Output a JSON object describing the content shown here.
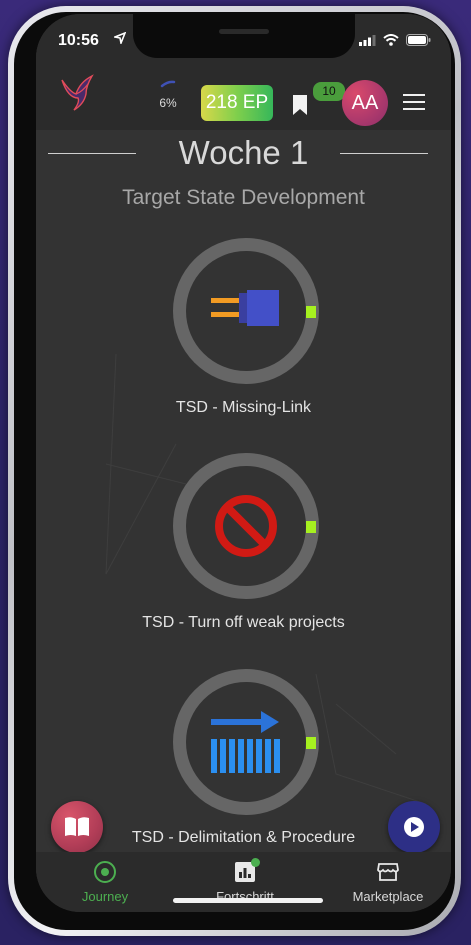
{
  "status": {
    "time": "10:56"
  },
  "header": {
    "progress": "6%",
    "progress_value": 0.06,
    "ep_label": "218 EP",
    "flag_count": "10",
    "avatar_initials": "AA"
  },
  "main": {
    "week_title": "Woche 1",
    "subtitle": "Target State Development",
    "modules": [
      {
        "label": "TSD - Missing-Link",
        "icon": "plug-icon"
      },
      {
        "label": "TSD - Turn off weak projects",
        "icon": "prohibited-icon"
      },
      {
        "label": "TSD - Delimitation & Procedure",
        "icon": "boxes-arrow-icon"
      }
    ]
  },
  "nav": {
    "items": [
      {
        "label": "Journey",
        "icon": "target-icon",
        "active": true
      },
      {
        "label": "Fortschritt",
        "icon": "bar-chart-icon"
      },
      {
        "label": "Marketplace",
        "icon": "store-icon"
      }
    ]
  },
  "colors": {
    "accent_green": "#4caf50",
    "tick_green": "#a6f020",
    "background": "#333333",
    "appbar": "#2b2b2b"
  }
}
